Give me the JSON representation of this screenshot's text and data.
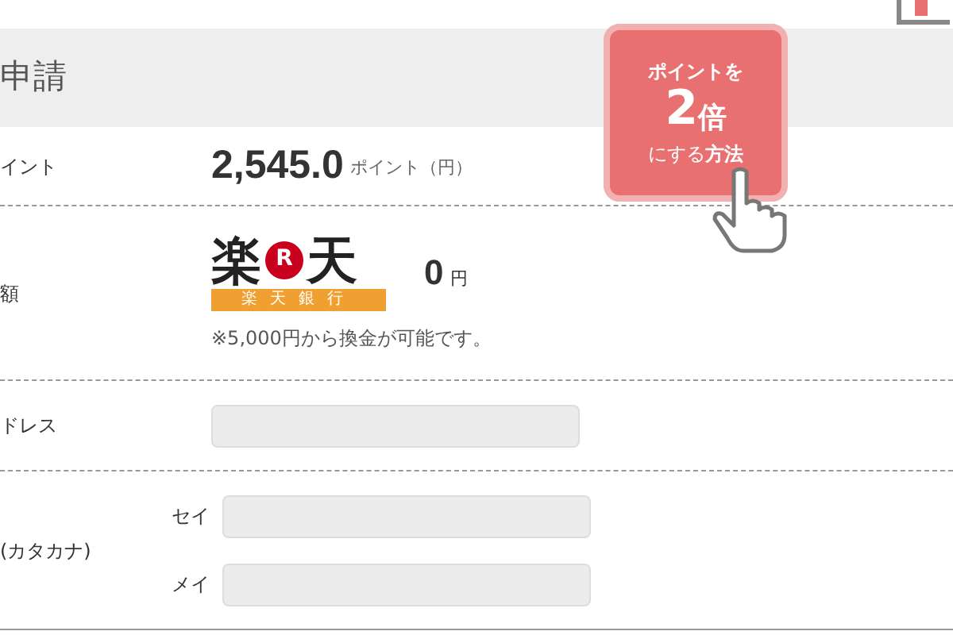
{
  "header": {
    "title": "申請"
  },
  "promo_badge": {
    "line_1": "ポイントを",
    "big": "2",
    "big_suffix": "倍",
    "line_3_plain": "にする",
    "line_3_bold": "方法"
  },
  "points_row": {
    "label": "イント",
    "value": "2,545.0",
    "unit": "ポイント（円）"
  },
  "bank_row": {
    "label": "額",
    "logo": {
      "left": "楽",
      "mark": "R",
      "right": "天",
      "band": "楽天銀行"
    },
    "amount": "0",
    "amount_unit": "円",
    "note": "※5,000円から換金が可能です。"
  },
  "address_row": {
    "label": "ドレス"
  },
  "name_row": {
    "label": "(カタカナ)",
    "fields": [
      {
        "label": "セイ"
      },
      {
        "label": "メイ"
      }
    ]
  }
}
